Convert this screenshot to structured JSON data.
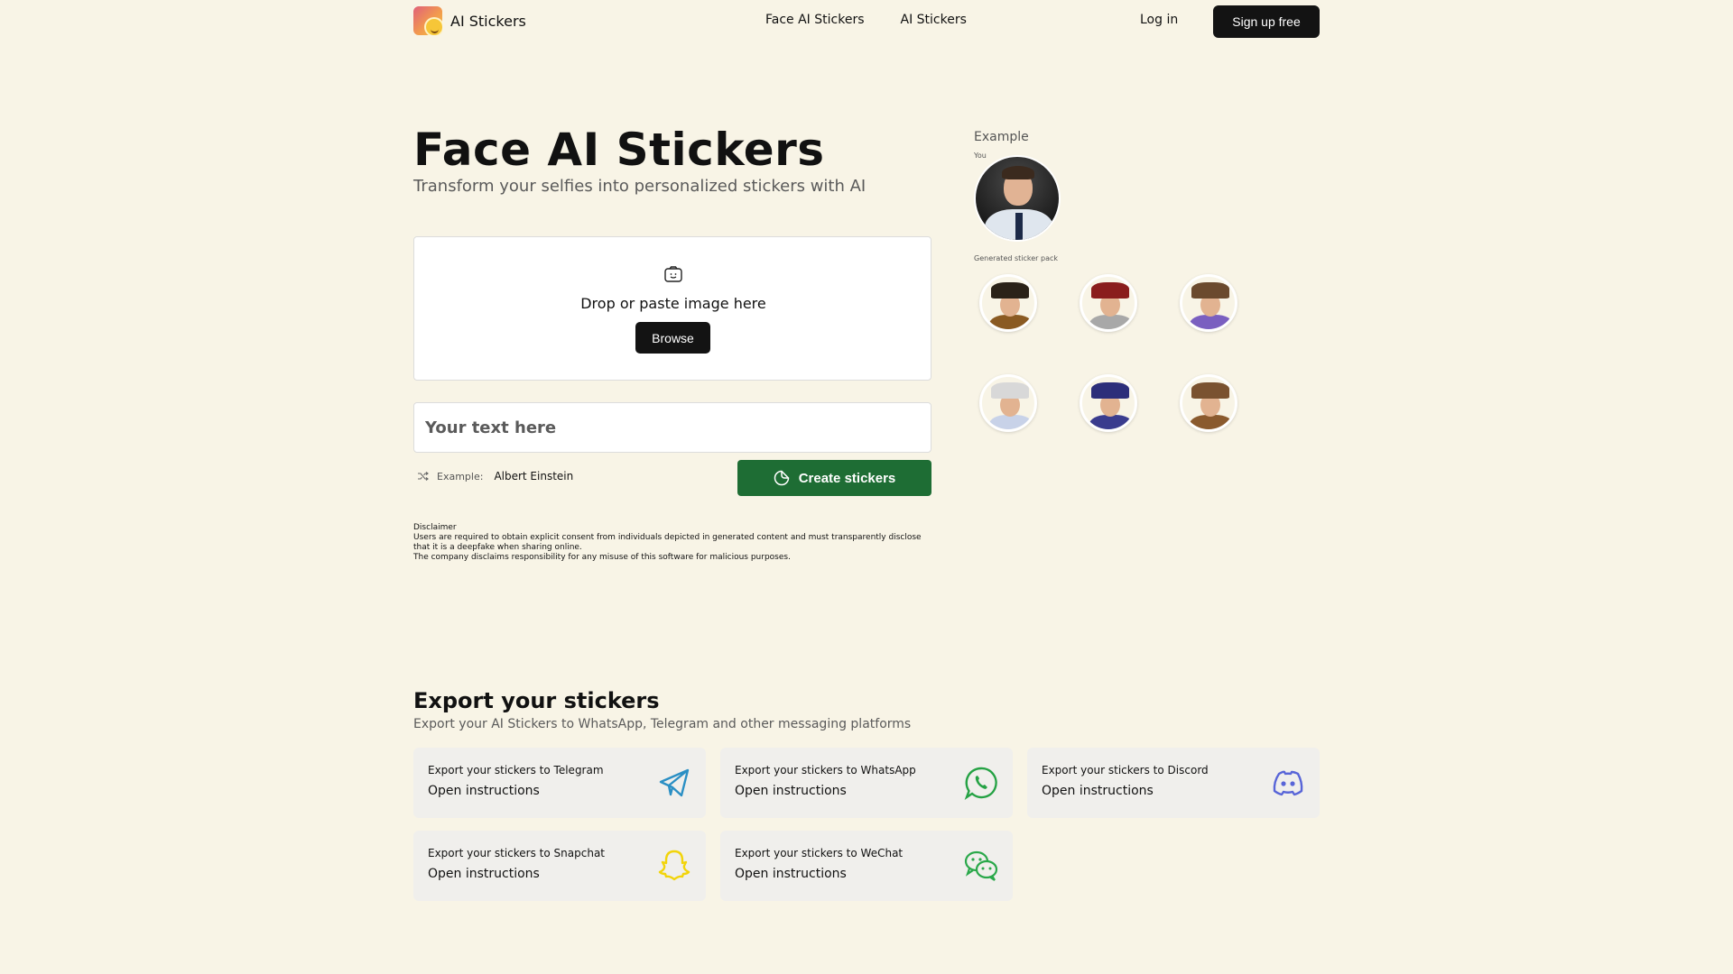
{
  "header": {
    "brand": "AI Stickers",
    "nav": [
      "Face AI Stickers",
      "AI Stickers"
    ],
    "login": "Log in",
    "signup": "Sign up free"
  },
  "hero": {
    "title": "Face AI Stickers",
    "subtitle": "Transform your selfies into personalized stickers with AI",
    "drop_text": "Drop or paste image here",
    "browse": "Browse",
    "text_placeholder": "Your text here",
    "example_label": "Example:",
    "example_value": "Albert Einstein",
    "create_button": "Create stickers"
  },
  "disclaimer": {
    "title": "Disclaimer",
    "line1": "Users are required to obtain explicit consent from individuals depicted in generated content and must transparently disclose that it is a deepfake when sharing online.",
    "line2": "The company disclaims responsibility for any misuse of this software for malicious purposes."
  },
  "example_panel": {
    "title": "Example",
    "you_label": "You",
    "generated_label": "Generated sticker pack",
    "stickers": [
      {
        "name": "pirate-sticker",
        "hat": "#2a2218",
        "body": "#8a5a22"
      },
      {
        "name": "roman-soldier-sticker",
        "hat": "#8a1d1d",
        "body": "#a8a8a8"
      },
      {
        "name": "smiling-man-sticker",
        "hat": "#6b4a2e",
        "body": "#7a5fc0"
      },
      {
        "name": "scientist-sticker",
        "hat": "#d8d8d8",
        "body": "#c8d2e8"
      },
      {
        "name": "wizard-sticker",
        "hat": "#2c2e7a",
        "body": "#3a3c8e"
      },
      {
        "name": "explorer-sticker",
        "hat": "#7a5230",
        "body": "#8a5a2e"
      }
    ]
  },
  "export": {
    "title": "Export your stickers",
    "subtitle": "Export your AI Stickers to WhatsApp, Telegram and other messaging platforms",
    "cards": [
      {
        "label": "Export your stickers to Telegram",
        "action": "Open instructions",
        "icon": "telegram-icon",
        "color": "#2a8fc4"
      },
      {
        "label": "Export your stickers to WhatsApp",
        "action": "Open instructions",
        "icon": "whatsapp-icon",
        "color": "#25a244"
      },
      {
        "label": "Export your stickers to Discord",
        "action": "Open instructions",
        "icon": "discord-icon",
        "color": "#5865d8"
      },
      {
        "label": "Export your stickers to Snapchat",
        "action": "Open instructions",
        "icon": "snapchat-icon",
        "color": "#f2d40a"
      },
      {
        "label": "Export your stickers to WeChat",
        "action": "Open instructions",
        "icon": "wechat-icon",
        "color": "#2aa84a"
      }
    ]
  }
}
